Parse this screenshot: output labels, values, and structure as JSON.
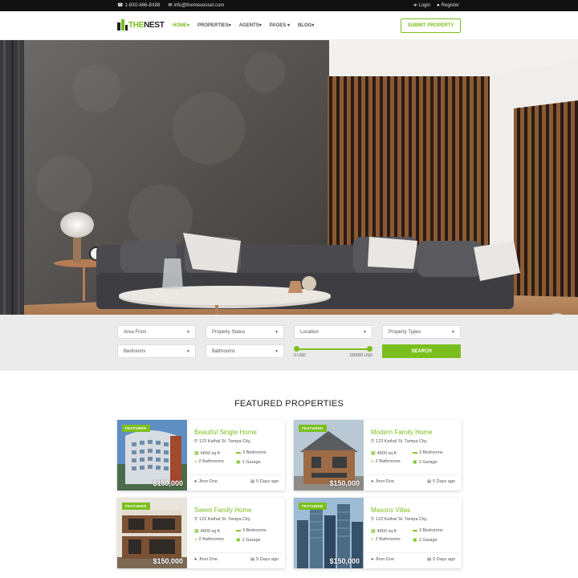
{
  "topbar": {
    "phone": "1-8X0-666-8X88",
    "email": "info@themevesset.com",
    "login": "Login",
    "register": "Register"
  },
  "header": {
    "logo_a": "THE",
    "logo_b": "NEST",
    "nav": [
      "HOME",
      "PROPERTIES",
      "AGENTS",
      "PAGES",
      "BLOG"
    ],
    "submit": "SUBMIT PROPERTY"
  },
  "search": {
    "area_from": "Area From",
    "status": "Property Status",
    "location": "Location",
    "types": "Property Types",
    "bedrooms": "Bedrooms",
    "bathrooms": "Bathrooms",
    "range_min": "0 USD",
    "range_max": "150000 USD",
    "button": "SEARCH"
  },
  "featured": {
    "title": "FEATURED PROPERTIES",
    "cards": [
      {
        "badge": "FEATURED",
        "price": "$150,000",
        "title": "Beautful Singte Home",
        "address": "123 Kathal St. Tampa City,",
        "area": "4800 sq ft",
        "bedrooms": "3 Bedrooms",
        "bathrooms": "2 Bathrooms",
        "garage": "1 Garage",
        "agent": "Jhon Doe",
        "date": "5 Days ago"
      },
      {
        "badge": "FEATURED",
        "price": "$150,000",
        "title": "Modern Family Home",
        "address": "123 Kathal St. Tampa City,",
        "area": "4800 sq ft",
        "bedrooms": "3 Bedrooms",
        "bathrooms": "2 Bathrooms",
        "garage": "1 Garage",
        "agent": "Jhon Doe",
        "date": "5 Days ago"
      },
      {
        "badge": "FEATURED",
        "price": "$150,000",
        "title": "Sweet Family Home",
        "address": "123 Kathal St. Tampa City,",
        "area": "4800 sq ft",
        "bedrooms": "3 Bedrooms",
        "bathrooms": "2 Bathrooms",
        "garage": "1 Garage",
        "agent": "Jhon Doe",
        "date": "5 Days ago"
      },
      {
        "badge": "FEATURED",
        "price": "$150,000",
        "title": "Masons Villas",
        "address": "123 Kathal St. Tampa City,",
        "area": "4800 sq ft",
        "bedrooms": "3 Bedrooms",
        "bathrooms": "2 Bathrooms",
        "garage": "1 Garage",
        "agent": "Jhon Doe",
        "date": "5 Days ago"
      }
    ]
  },
  "colors": {
    "accent": "#7bbf1e",
    "topbar": "#111111"
  }
}
